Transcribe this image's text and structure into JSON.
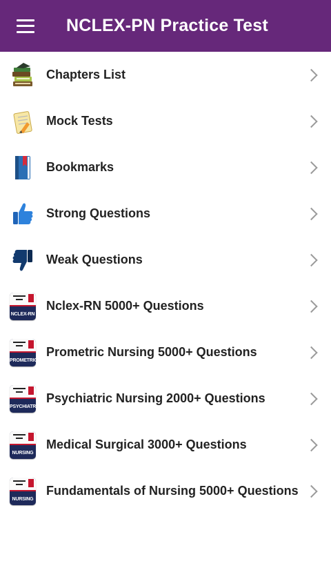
{
  "appbar": {
    "title": "NCLEX-PN Practice Test",
    "color": "#66287a"
  },
  "menu": {
    "items": [
      {
        "label": "Chapters List",
        "icon": "books-icon"
      },
      {
        "label": "Mock Tests",
        "icon": "notepad-pencil-icon"
      },
      {
        "label": "Bookmarks",
        "icon": "bookmark-book-icon"
      },
      {
        "label": "Strong Questions",
        "icon": "thumbs-up-icon"
      },
      {
        "label": "Weak Questions",
        "icon": "thumbs-down-icon"
      },
      {
        "label": "Nclex-RN 5000+ Questions",
        "icon": "nclex-badge-icon",
        "badge": "NCLEX-RN"
      },
      {
        "label": "Prometric Nursing 5000+ Questions",
        "icon": "prometric-badge-icon",
        "badge": "PROMETRIC"
      },
      {
        "label": "Psychiatric Nursing 2000+ Questions",
        "icon": "psychiatric-badge-icon",
        "badge": "PSYCHIATRIC"
      },
      {
        "label": "Medical Surgical 3000+ Questions",
        "icon": "medical-surgical-badge-icon",
        "badge": "NURSING"
      },
      {
        "label": "Fundamentals of Nursing 5000+ Questions",
        "icon": "fundamentals-badge-icon",
        "badge": "NURSING"
      }
    ]
  }
}
